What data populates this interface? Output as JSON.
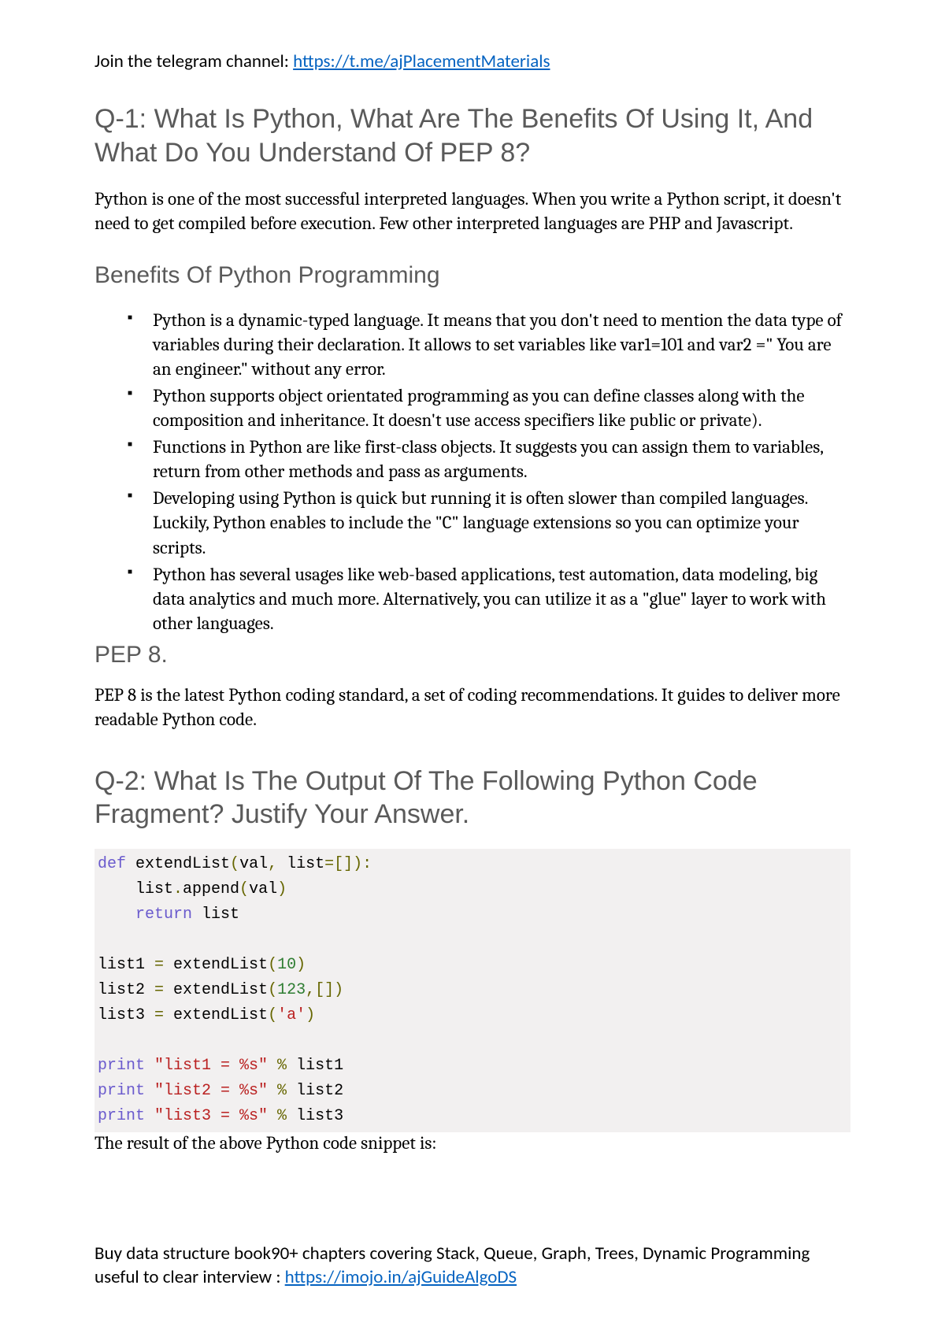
{
  "header": {
    "prefix": "Join the telegram channel: ",
    "link_text": "https://t.me/ajPlacementMaterials"
  },
  "q1": {
    "heading": "Q-1: What Is Python, What Are The Benefits Of Using It, And What Do You Understand Of PEP 8?",
    "intro": "Python is one of the most successful interpreted languages. When you write a Python script, it doesn't need to get compiled before execution. Few other interpreted languages are PHP and Javascript.",
    "benefits_heading": "Benefits Of Python Programming",
    "benefits": [
      "Python is a dynamic-typed language. It means that you don't need to mention the data type of variables during their declaration. It allows to set variables like var1=101 and var2 =\" You are an engineer.\" without any error.",
      "Python supports object orientated programming as you can define classes along with the composition and inheritance. It doesn't use access specifiers like public or private).",
      "Functions in Python are like first-class objects. It suggests you can assign them to variables, return from other methods and pass as arguments.",
      "Developing using Python is quick but running it is often slower than compiled languages. Luckily, Python enables to include the \"C\" language extensions so you can optimize your scripts.",
      "Python has several usages like web-based applications, test automation, data modeling, big data analytics and much more. Alternatively, you can utilize it as a \"glue\" layer to work with other languages."
    ],
    "pep_heading": "PEP 8.",
    "pep_body": "PEP 8 is the latest Python coding standard, a set of coding recommendations. It guides to deliver more readable Python code."
  },
  "q2": {
    "heading": "Q-2: What Is The Output Of The Following Python Code Fragment? Justify Your Answer.",
    "code": {
      "l1_def": "def",
      "l1_fn": " extendList",
      "l1_a": "(",
      "l1_val": "val",
      "l1_c": ", ",
      "l1_list": "list",
      "l1_eq": "=[]):",
      "l2_pre": "    list",
      "l2_dot": ".",
      "l2_app": "append",
      "l2_a": "(",
      "l2_v": "val",
      "l2_b": ")",
      "l3_ret": "    return",
      "l3_list": " list",
      "l5_a": "list1 ",
      "l5_eq": "=",
      "l5_b": " extendList",
      "l5_p": "(",
      "l5_n": "10",
      "l5_q": ")",
      "l6_a": "list2 ",
      "l6_eq": "=",
      "l6_b": " extendList",
      "l6_p": "(",
      "l6_n": "123",
      "l6_c": ",[])",
      "l7_a": "list3 ",
      "l7_eq": "=",
      "l7_b": " extendList",
      "l7_p": "(",
      "l7_s": "'a'",
      "l7_q": ")",
      "l9_p": "print",
      "l9_s": " \"list1 = %s\"",
      "l9_o": " %",
      "l9_v": " list1",
      "l10_p": "print",
      "l10_s": " \"list2 = %s\"",
      "l10_o": " %",
      "l10_v": " list2",
      "l11_p": "print",
      "l11_s": " \"list3 = %s\"",
      "l11_o": " %",
      "l11_v": " list3"
    },
    "after_code": "The result of the above Python code snippet is:"
  },
  "footer": {
    "text": "Buy data structure book90+ chapters covering Stack, Queue, Graph, Trees, Dynamic Programming useful to clear interview : ",
    "link_text": "https://imojo.in/ajGuideAlgoDS"
  }
}
